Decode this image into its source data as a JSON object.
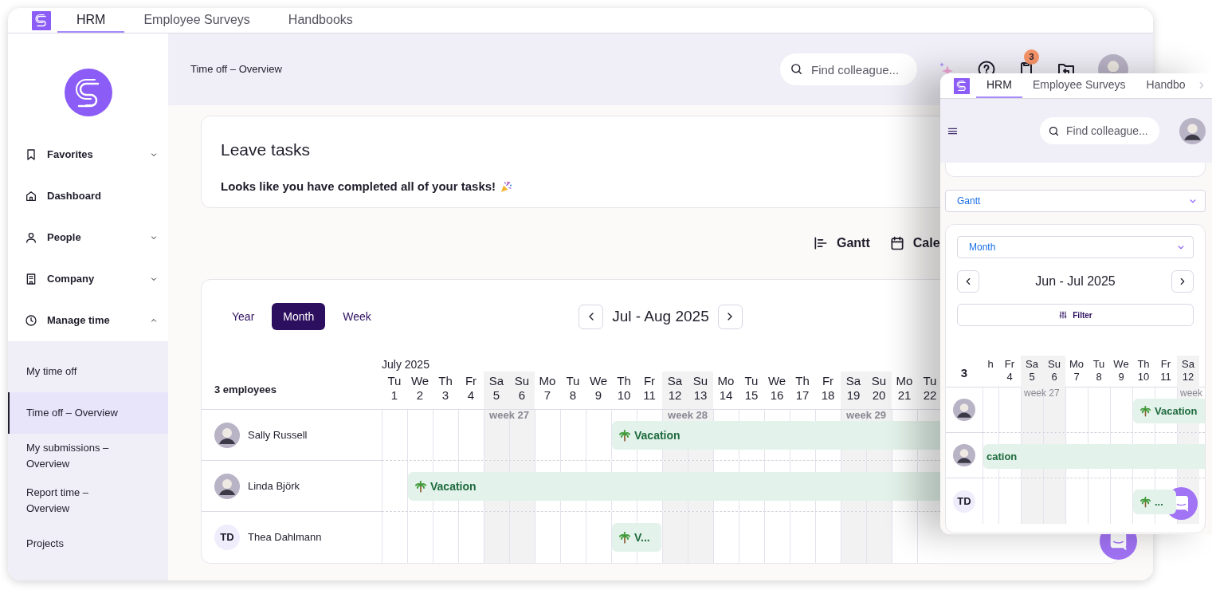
{
  "app_tabs": [
    {
      "label": "HRM",
      "selected": true
    },
    {
      "label": "Employee Surveys",
      "selected": false
    },
    {
      "label": "Handbooks",
      "selected": false
    }
  ],
  "sidebar": {
    "items": [
      {
        "label": "Favorites",
        "kind": "group",
        "expanded": false
      },
      {
        "label": "Dashboard",
        "kind": "link"
      },
      {
        "label": "People",
        "kind": "group",
        "expanded": false
      },
      {
        "label": "Company",
        "kind": "group",
        "expanded": false
      },
      {
        "label": "Manage time",
        "kind": "group",
        "expanded": true,
        "children": [
          {
            "label": "My time off",
            "selected": false
          },
          {
            "label": "Time off – Overview",
            "selected": true
          },
          {
            "label": "My submissions – Overview",
            "selected": false
          },
          {
            "label": "Report time – Overview",
            "selected": false
          },
          {
            "label": "Projects",
            "selected": false
          }
        ]
      }
    ]
  },
  "header": {
    "breadcrumb": "Time off – Overview",
    "search": {
      "placeholder": "Find colleague..."
    },
    "notification_count": "3"
  },
  "leave_tasks": {
    "title": "Leave tasks",
    "message": "Looks like you have completed all of your tasks!"
  },
  "view_options": [
    {
      "label": "Gantt"
    },
    {
      "label": "Cale"
    }
  ],
  "gantt": {
    "ranges": [
      {
        "label": "Year",
        "selected": false
      },
      {
        "label": "Month",
        "selected": true
      },
      {
        "label": "Week",
        "selected": false
      }
    ],
    "period": "Jul - Aug 2025",
    "month": "July 2025",
    "employee_count": "3 employees",
    "days": [
      {
        "day": "Tu",
        "date": "1",
        "weekend": false
      },
      {
        "day": "We",
        "date": "2",
        "weekend": false
      },
      {
        "day": "Th",
        "date": "3",
        "weekend": false
      },
      {
        "day": "Fr",
        "date": "4",
        "weekend": false
      },
      {
        "day": "Sa",
        "date": "5",
        "weekend": true,
        "week": "week 27"
      },
      {
        "day": "Su",
        "date": "6",
        "weekend": true
      },
      {
        "day": "Mo",
        "date": "7",
        "weekend": false
      },
      {
        "day": "Tu",
        "date": "8",
        "weekend": false
      },
      {
        "day": "We",
        "date": "9",
        "weekend": false
      },
      {
        "day": "Th",
        "date": "10",
        "weekend": false
      },
      {
        "day": "Fr",
        "date": "11",
        "weekend": false
      },
      {
        "day": "Sa",
        "date": "12",
        "weekend": true,
        "week": "week 28"
      },
      {
        "day": "Su",
        "date": "13",
        "weekend": true
      },
      {
        "day": "Mo",
        "date": "14",
        "weekend": false
      },
      {
        "day": "Tu",
        "date": "15",
        "weekend": false
      },
      {
        "day": "We",
        "date": "16",
        "weekend": false
      },
      {
        "day": "Th",
        "date": "17",
        "weekend": false
      },
      {
        "day": "Fr",
        "date": "18",
        "weekend": false
      },
      {
        "day": "Sa",
        "date": "19",
        "weekend": true,
        "week": "week 29"
      },
      {
        "day": "Su",
        "date": "20",
        "weekend": true
      },
      {
        "day": "Mo",
        "date": "21",
        "weekend": false
      },
      {
        "day": "Tu",
        "date": "22",
        "weekend": false
      }
    ],
    "rows": [
      {
        "name": "Sally Russell",
        "kind": "photo",
        "cells": [
          {
            "kind": "free"
          },
          {
            "kind": "free"
          },
          {
            "kind": "free"
          },
          {
            "kind": "free"
          },
          {
            "kind": "free"
          },
          {
            "kind": "free"
          },
          {
            "kind": "free"
          },
          {
            "kind": "free"
          },
          {
            "kind": "free"
          },
          {
            "kind": "vacation",
            "label": "Vacation"
          },
          {
            "kind": "vacation"
          },
          {
            "kind": "vacation"
          },
          {
            "kind": "vacation"
          },
          {
            "kind": "vacation"
          },
          {
            "kind": "vacation"
          },
          {
            "kind": "vacation"
          },
          {
            "kind": "vacation"
          },
          {
            "kind": "vacation"
          },
          {
            "kind": "vacation"
          },
          {
            "kind": "vacation"
          },
          {
            "kind": "vacation"
          },
          {
            "kind": "vacation"
          }
        ]
      },
      {
        "name": "Linda Björk",
        "kind": "photo",
        "cells": [
          {
            "kind": "free"
          },
          {
            "kind": "vacation",
            "label": "Vacation"
          },
          {
            "kind": "vacation"
          },
          {
            "kind": "vacation"
          },
          {
            "kind": "vacation"
          },
          {
            "kind": "vacation"
          },
          {
            "kind": "vacation"
          },
          {
            "kind": "vacation"
          },
          {
            "kind": "vacation"
          },
          {
            "kind": "vacation"
          },
          {
            "kind": "vacation"
          },
          {
            "kind": "vacation"
          },
          {
            "kind": "vacation"
          },
          {
            "kind": "vacation"
          },
          {
            "kind": "vacation"
          },
          {
            "kind": "vacation"
          },
          {
            "kind": "vacation"
          },
          {
            "kind": "vacation"
          },
          {
            "kind": "vacation"
          },
          {
            "kind": "vacation"
          },
          {
            "kind": "vacation"
          },
          {
            "kind": "vacation"
          }
        ]
      },
      {
        "name": "Thea Dahlmann",
        "kind": "initials",
        "initials": "TD",
        "cells": [
          {
            "kind": "free"
          },
          {
            "kind": "free"
          },
          {
            "kind": "free"
          },
          {
            "kind": "free"
          },
          {
            "kind": "free"
          },
          {
            "kind": "free"
          },
          {
            "kind": "free"
          },
          {
            "kind": "free"
          },
          {
            "kind": "free"
          },
          {
            "kind": "vacation",
            "label": "V..."
          },
          {
            "kind": "vacation"
          },
          {
            "kind": "free"
          },
          {
            "kind": "free"
          },
          {
            "kind": "free"
          },
          {
            "kind": "free"
          },
          {
            "kind": "free"
          },
          {
            "kind": "free"
          },
          {
            "kind": "free"
          },
          {
            "kind": "free"
          },
          {
            "kind": "free"
          },
          {
            "kind": "free"
          },
          {
            "kind": "free"
          }
        ]
      }
    ]
  },
  "mobile": {
    "tabs": [
      {
        "label": "HRM",
        "selected": true
      },
      {
        "label": "Employee Surveys",
        "selected": false
      },
      {
        "label": "Handbo",
        "selected": false
      }
    ],
    "search": {
      "placeholder": "Find colleague..."
    },
    "view_select": "Gantt",
    "range_select": "Month",
    "period": "Jun - Jul 2025",
    "filter": "Filter",
    "employee_count": "3",
    "days": [
      {
        "day": "h",
        "weekend": false
      },
      {
        "day": "Fr",
        "date": "4",
        "weekend": false
      },
      {
        "day": "Sa",
        "date": "5",
        "weekend": true,
        "week": "week 27"
      },
      {
        "day": "Su",
        "date": "6",
        "weekend": true
      },
      {
        "day": "Mo",
        "date": "7",
        "weekend": false
      },
      {
        "day": "Tu",
        "date": "8",
        "weekend": false
      },
      {
        "day": "We",
        "date": "9",
        "weekend": false
      },
      {
        "day": "Th",
        "date": "10",
        "weekend": false
      },
      {
        "day": "Fr",
        "date": "11",
        "weekend": false
      },
      {
        "day": "Sa",
        "date": "12",
        "weekend": true,
        "week": "week"
      }
    ],
    "rows": [
      {
        "kind": "photo",
        "cells": [
          {
            "kind": "free"
          },
          {
            "kind": "free"
          },
          {
            "kind": "free"
          },
          {
            "kind": "free"
          },
          {
            "kind": "free"
          },
          {
            "kind": "free"
          },
          {
            "kind": "free"
          },
          {
            "kind": "vacation",
            "label": "Vacation"
          },
          {
            "kind": "vacation"
          },
          {
            "kind": "vacation"
          }
        ]
      },
      {
        "kind": "photo",
        "cells": [
          {
            "kind": "vacation",
            "label": "cation"
          },
          {
            "kind": "vacation"
          },
          {
            "kind": "vacation"
          },
          {
            "kind": "vacation"
          },
          {
            "kind": "vacation"
          },
          {
            "kind": "vacation"
          },
          {
            "kind": "vacation"
          },
          {
            "kind": "vacation"
          },
          {
            "kind": "vacation"
          },
          {
            "kind": "vacation"
          }
        ]
      },
      {
        "kind": "initials",
        "initials": "TD",
        "cells": [
          {
            "kind": "free"
          },
          {
            "kind": "free"
          },
          {
            "kind": "free"
          },
          {
            "kind": "free"
          },
          {
            "kind": "free"
          },
          {
            "kind": "free"
          },
          {
            "kind": "free"
          },
          {
            "kind": "vacation",
            "label": "..."
          },
          {
            "kind": "vacation"
          },
          {
            "kind": "free"
          }
        ]
      }
    ]
  }
}
